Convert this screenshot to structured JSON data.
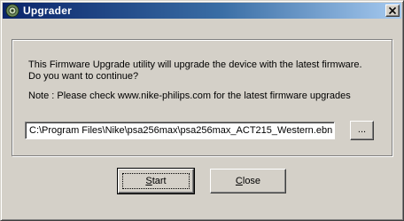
{
  "window": {
    "title": "Upgrader"
  },
  "titlebar": {
    "close_icon": "close-icon"
  },
  "dialog": {
    "message_line1": "This Firmware Upgrade utility will upgrade the device with the latest firmware.",
    "message_line2": "Do you want to continue?",
    "note": "Note : Please check www.nike-philips.com for the latest firmware upgrades",
    "file_path": "C:\\Program Files\\Nike\\psa256max\\psa256max_ACT215_Western.ebn",
    "browse_label": "...",
    "start_label_first": "S",
    "start_label_rest": "tart",
    "close_label_first": "C",
    "close_label_rest": "lose"
  },
  "colors": {
    "face": "#d4d0c8",
    "title_start": "#0a246a",
    "title_end": "#a6caf0"
  }
}
